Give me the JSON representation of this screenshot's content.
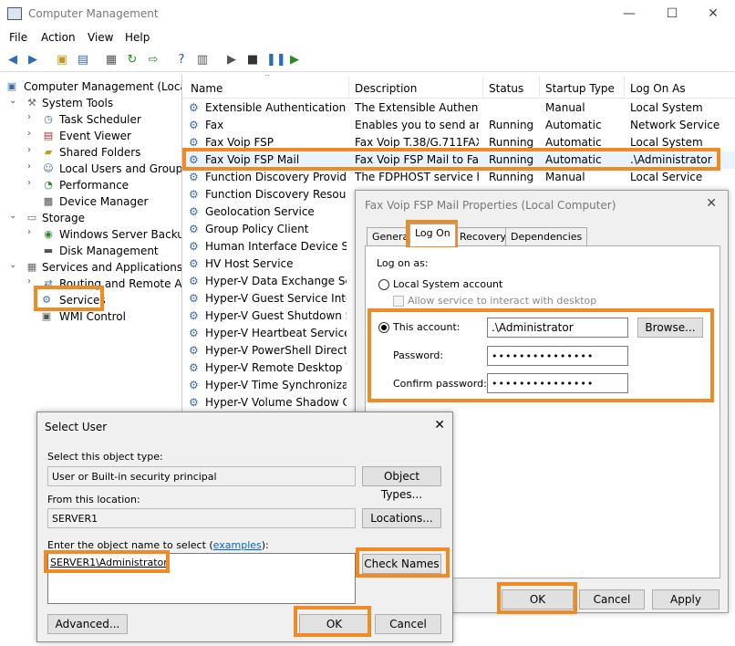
{
  "window": {
    "title": "Computer Management",
    "controls": {
      "minimize": "—",
      "maximize": "☐",
      "close": "✕"
    }
  },
  "menu": [
    "File",
    "Action",
    "View",
    "Help"
  ],
  "tree": {
    "root": "Computer Management (Local)",
    "items": [
      "System Tools",
      "Task Scheduler",
      "Event Viewer",
      "Shared Folders",
      "Local Users and Groups",
      "Performance",
      "Device Manager",
      "Storage",
      "Windows Server Backup",
      "Disk Management",
      "Services and Applications",
      "Routing and Remote Acc",
      "Services",
      "WMI Control"
    ]
  },
  "services": {
    "columns": [
      "Name",
      "Description",
      "Status",
      "Startup Type",
      "Log On As"
    ],
    "rows": [
      [
        "Extensible Authentication P...",
        "The Extensible Authenti...",
        "",
        "Manual",
        "Local System"
      ],
      [
        "Fax",
        "Enables you to send an...",
        "Running",
        "Automatic",
        "Network Service"
      ],
      [
        "Fax Voip FSP",
        "Fax Voip T.38/G.711FAX ...",
        "Running",
        "Automatic",
        "Local System"
      ],
      [
        "Fax Voip FSP Mail",
        "Fax Voip FSP Mail to Fax...",
        "Running",
        "Automatic",
        ".\\Administrator"
      ],
      [
        "Function Discovery Provide...",
        "The FDPHOST service h...",
        "Running",
        "Manual",
        "Local Service"
      ],
      [
        "Function Discovery Resourc...",
        "",
        "",
        "",
        ""
      ],
      [
        "Geolocation Service",
        "",
        "",
        "",
        ""
      ],
      [
        "Group Policy Client",
        "",
        "",
        "",
        ""
      ],
      [
        "Human Interface Device Ser...",
        "",
        "",
        "",
        ""
      ],
      [
        "HV Host Service",
        "",
        "",
        "",
        ""
      ],
      [
        "Hyper-V Data Exchange Ser...",
        "",
        "",
        "",
        ""
      ],
      [
        "Hyper-V Guest Service Inter...",
        "",
        "",
        "",
        ""
      ],
      [
        "Hyper-V Guest Shutdown S...",
        "",
        "",
        "",
        ""
      ],
      [
        "Hyper-V Heartbeat Service",
        "",
        "",
        "",
        ""
      ],
      [
        "Hyper-V PowerShell Direct ...",
        "",
        "",
        "",
        ""
      ],
      [
        "Hyper-V Remote Desktop Vi...",
        "",
        "",
        "",
        ""
      ],
      [
        "Hyper-V Time Synchronizat...",
        "",
        "",
        "",
        ""
      ],
      [
        "Hyper-V Volume Shadow C...",
        "",
        "",
        "",
        ""
      ]
    ]
  },
  "properties": {
    "title": "Fax Voip FSP Mail Properties (Local Computer)",
    "tabs": [
      "General",
      "Log On",
      "Recovery",
      "Dependencies"
    ],
    "logon_as": "Log on as:",
    "local_system": "Local System account",
    "allow_desktop": "Allow service to interact with desktop",
    "this_account": "This account:",
    "account_value": ".\\Administrator",
    "browse": "Browse...",
    "password_label": "Password:",
    "password_value": "•••••••••••••••",
    "confirm_label": "Confirm password:",
    "confirm_value": "•••••••••••••••",
    "ok": "OK",
    "cancel": "Cancel",
    "apply": "Apply"
  },
  "select_user": {
    "title": "Select User",
    "object_type_label": "Select this object type:",
    "object_type_value": "User or Built-in security principal",
    "object_types_btn": "Object Types...",
    "location_label": "From this location:",
    "location_value": "SERVER1",
    "locations_btn": "Locations...",
    "enter_label_pre": "Enter the object name to select (",
    "enter_label_link": "examples",
    "enter_label_post": "):",
    "object_name": "SERVER1\\Administrator",
    "check_names": "Check Names",
    "advanced": "Advanced...",
    "ok": "OK",
    "cancel": "Cancel"
  },
  "colors": {
    "highlight": "#f08a24",
    "selection": "#e9f3fd",
    "link": "#0066cc"
  }
}
